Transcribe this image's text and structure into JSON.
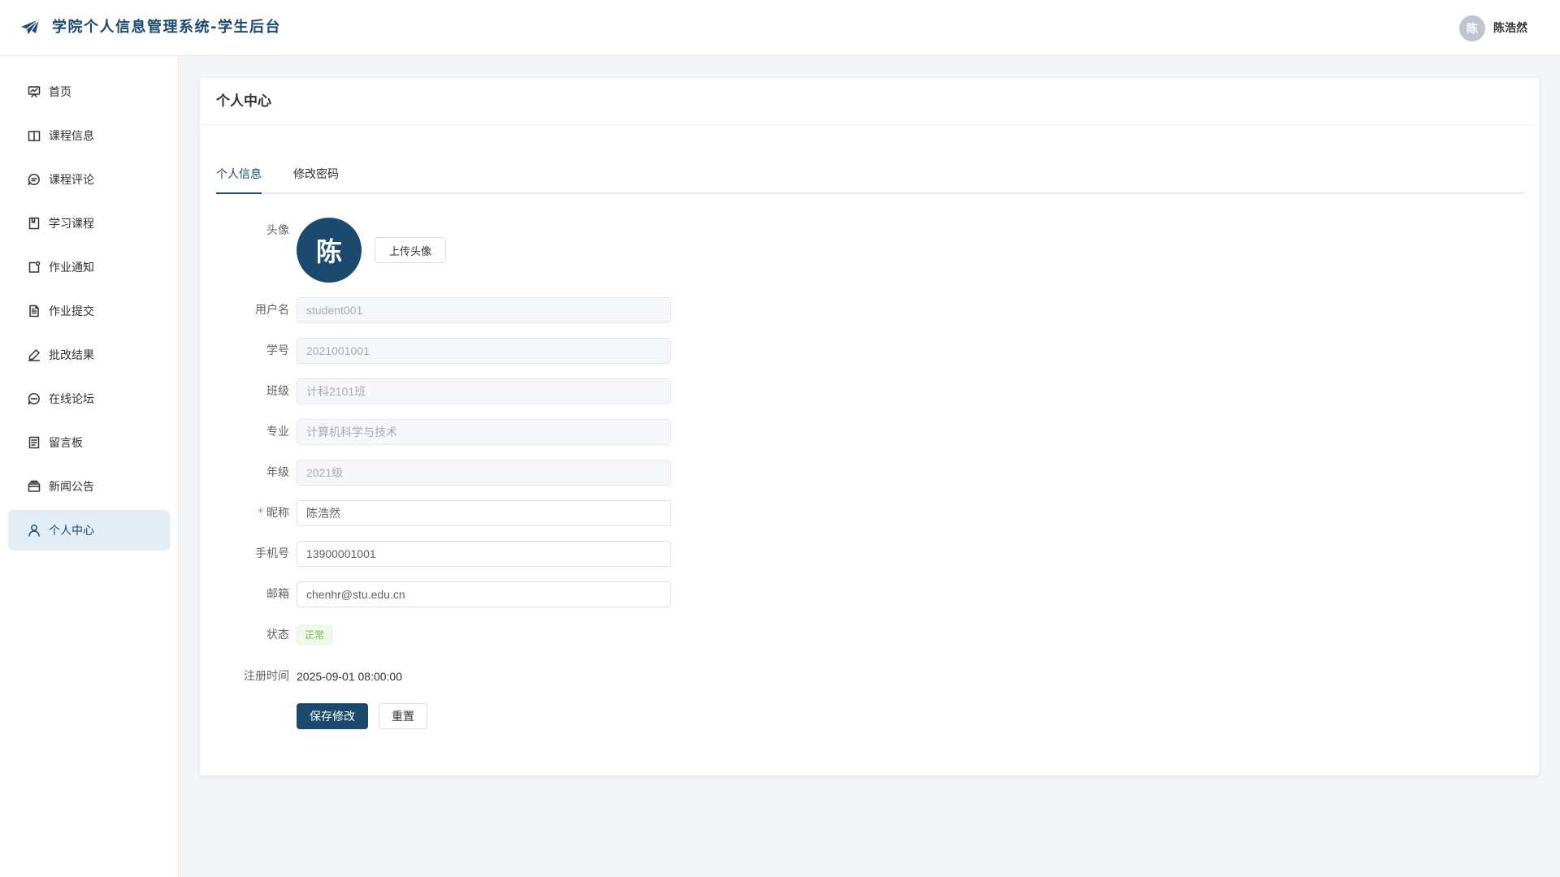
{
  "header": {
    "app_title": "学院个人信息管理系统-学生后台",
    "logo_icon": "paper-plane-icon",
    "user_avatar_initial": "陈",
    "user_name": "陈浩然"
  },
  "sidebar": {
    "items": [
      {
        "label": "首页",
        "icon": "dashboard-icon"
      },
      {
        "label": "课程信息",
        "icon": "book-icon"
      },
      {
        "label": "课程评论",
        "icon": "comment-icon"
      },
      {
        "label": "学习课程",
        "icon": "notebook-icon"
      },
      {
        "label": "作业通知",
        "icon": "notification-icon"
      },
      {
        "label": "作业提交",
        "icon": "document-icon"
      },
      {
        "label": "批改结果",
        "icon": "edit-pen-icon"
      },
      {
        "label": "在线论坛",
        "icon": "chat-dots-icon"
      },
      {
        "label": "留言板",
        "icon": "tickets-icon"
      },
      {
        "label": "新闻公告",
        "icon": "suitcase-icon"
      },
      {
        "label": "个人中心",
        "icon": "user-icon",
        "active": true
      }
    ]
  },
  "main": {
    "card_title": "个人中心",
    "tabs": [
      {
        "label": "个人信息",
        "active": true
      },
      {
        "label": "修改密码",
        "active": false
      }
    ],
    "form": {
      "avatar_label": "头像",
      "avatar_initial": "陈",
      "upload_button": "上传头像",
      "username": {
        "label": "用户名",
        "value": "student001"
      },
      "student_id": {
        "label": "学号",
        "value": "2021001001"
      },
      "class_name": {
        "label": "班级",
        "value": "计科2101班"
      },
      "major": {
        "label": "专业",
        "value": "计算机科学与技术"
      },
      "grade": {
        "label": "年级",
        "value": "2021级"
      },
      "nickname": {
        "label": "昵称",
        "required_mark": "*",
        "value": "陈浩然"
      },
      "phone": {
        "label": "手机号",
        "value": "13900001001"
      },
      "email": {
        "label": "邮箱",
        "value": "chenhr@stu.edu.cn"
      },
      "status": {
        "label": "状态",
        "value": "正常"
      },
      "register_time": {
        "label": "注册时间",
        "value": "2025-09-01 08:00:00"
      },
      "save_button": "保存修改",
      "reset_button": "重置"
    }
  },
  "colors": {
    "primary": "#1c4a6e",
    "active_menu_bg": "#e3edf6",
    "success": "#67c23a",
    "required": "#f56c6c"
  }
}
